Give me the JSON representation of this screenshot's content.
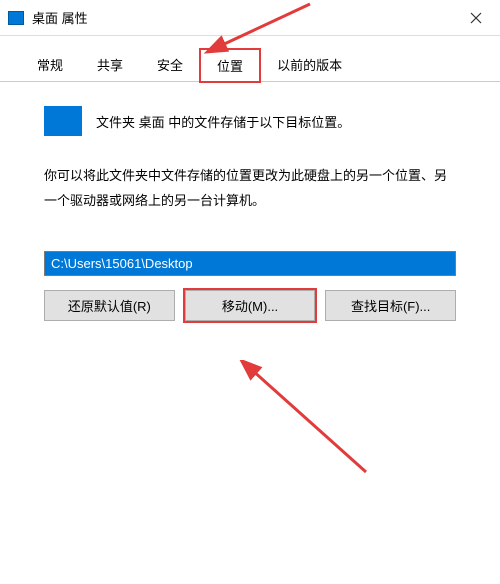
{
  "titlebar": {
    "title": "桌面 属性"
  },
  "tabs": {
    "items": [
      {
        "label": "常规"
      },
      {
        "label": "共享"
      },
      {
        "label": "安全"
      },
      {
        "label": "位置"
      },
      {
        "label": "以前的版本"
      }
    ]
  },
  "content": {
    "folder_text": "文件夹 桌面 中的文件存储于以下目标位置。",
    "description": "你可以将此文件夹中文件存储的位置更改为此硬盘上的另一个位置、另一个驱动器或网络上的另一台计算机。",
    "path_value": "C:\\Users\\15061\\Desktop"
  },
  "buttons": {
    "restore": "还原默认值(R)",
    "move": "移动(M)...",
    "find": "查找目标(F)..."
  }
}
